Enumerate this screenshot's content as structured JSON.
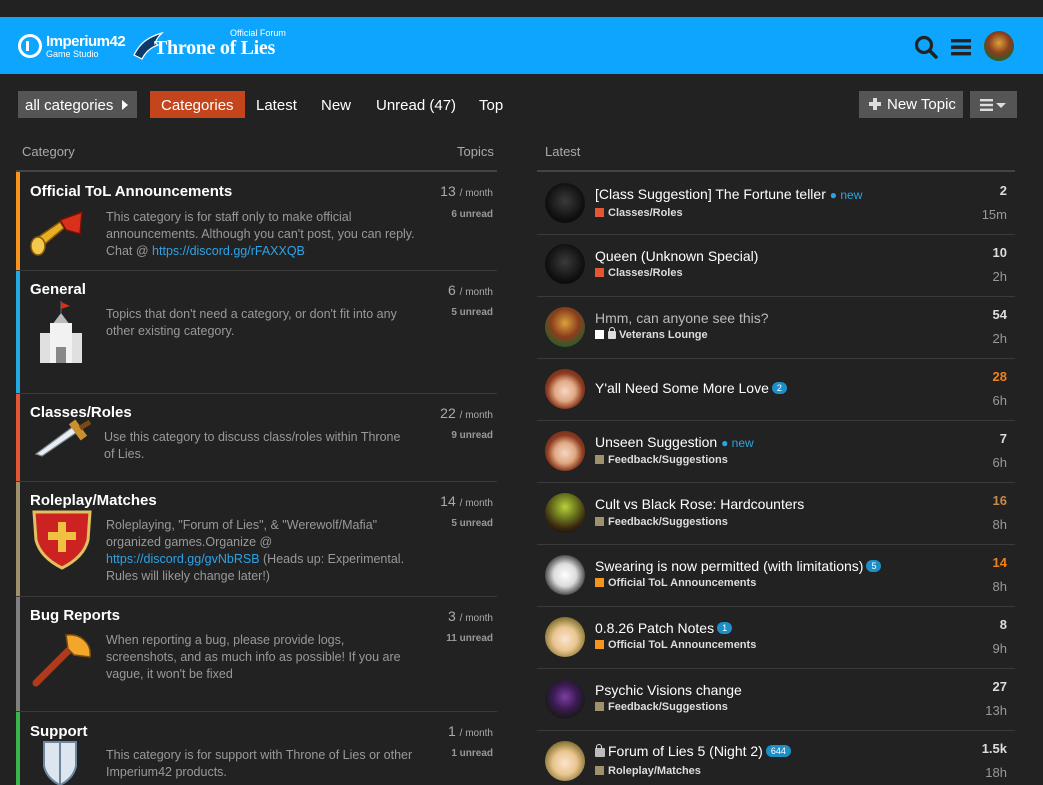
{
  "header": {
    "logo_main": "Imperium42",
    "logo_sub": "Game Studio",
    "forum_tag": "Official Forum",
    "forum_name": "Throne of Lies",
    "brand_color": "#0ea5ff"
  },
  "nav": {
    "category_dropdown": "all categories",
    "tabs": [
      {
        "label": "Categories",
        "active": true
      },
      {
        "label": "Latest"
      },
      {
        "label": "New"
      },
      {
        "label": "Unread (47)"
      },
      {
        "label": "Top"
      }
    ],
    "new_topic": "New Topic"
  },
  "categories_column": {
    "header": "Category",
    "topics_header": "Topics"
  },
  "latest_column": {
    "header": "Latest"
  },
  "categories": [
    {
      "name": "Official ToL Announcements",
      "desc_a": "This category is for staff only to make official announcements. Although you can't post, you can reply. Chat @ ",
      "link": "https://discord.gg/rFAXXQB",
      "desc_b": "",
      "count": "13",
      "unit": "/ month",
      "unread": "6 unread",
      "color": "#f7941d",
      "icon": "horn-icon"
    },
    {
      "name": "General",
      "desc_a": "Topics that don't need a category, or don't fit into any other existing category.",
      "link": "",
      "desc_b": "",
      "count": "6",
      "unit": "/ month",
      "unread": "5 unread",
      "color": "#25aae2",
      "icon": "castle-icon"
    },
    {
      "name": "Classes/Roles",
      "desc_a": "Use this category to discuss class/roles within Throne of Lies.",
      "link": "",
      "desc_b": "",
      "count": "22",
      "unit": "/ month",
      "unread": "9 unread",
      "color": "#e45735",
      "icon": "dagger-icon"
    },
    {
      "name": "Roleplay/Matches",
      "desc_a": "Roleplaying, \"Forum of Lies\", & \"Werewolf/Mafia\" organized games.Organize @ ",
      "link": "https://discord.gg/gvNbRSB",
      "desc_b": " (Heads up: Experimental. Rules will likely change later!)",
      "count": "14",
      "unit": "/ month",
      "unread": "5 unread",
      "color": "#a0916d",
      "icon": "shield-cross-icon"
    },
    {
      "name": "Bug Reports",
      "desc_a": "When reporting a bug, please provide logs, screenshots, and as much info as possible! If you are vague, it won't be fixed",
      "link": "",
      "desc_b": "",
      "count": "3",
      "unit": "/ month",
      "unread": "11 unread",
      "color": "#808080",
      "icon": "axe-icon"
    },
    {
      "name": "Support",
      "desc_a": "This category is for support with Throne of Lies or other Imperium42 products.",
      "link": "",
      "desc_b": "",
      "count": "1",
      "unit": "/ month",
      "unread": "1 unread",
      "color": "#3ab54a",
      "icon": "shield-icon"
    }
  ],
  "topics": [
    {
      "title": "[Class Suggestion] The Fortune teller",
      "new": "● new",
      "badge": "",
      "category": "Classes/Roles",
      "cat_color": "#e45735",
      "locked": false,
      "posts": "2",
      "posts_style": "",
      "age": "15m",
      "avatar": "dark-figure"
    },
    {
      "title": "Queen (Unknown Special)",
      "new": "",
      "badge": "",
      "category": "Classes/Roles",
      "cat_color": "#e45735",
      "locked": false,
      "posts": "10",
      "posts_style": "",
      "age": "2h",
      "avatar": "dark-figure"
    },
    {
      "title": "Hmm, can anyone see this?",
      "new": "",
      "badge": "",
      "category": "Veterans Lounge",
      "cat_color": "#ffffff",
      "locked": true,
      "posts": "54",
      "posts_style": "",
      "age": "2h",
      "avatar": "king-portrait",
      "read": true
    },
    {
      "title": "Y'all Need Some More Love",
      "new": "",
      "badge": "2",
      "category": "",
      "cat_color": "",
      "locked": false,
      "posts": "28",
      "posts_style": "hot",
      "age": "6h",
      "avatar": "anime-girl-brown"
    },
    {
      "title": "Unseen Suggestion",
      "new": "● new",
      "badge": "",
      "category": "Feedback/Suggestions",
      "cat_color": "#a0916d",
      "locked": false,
      "posts": "7",
      "posts_style": "",
      "age": "6h",
      "avatar": "anime-girl-brown"
    },
    {
      "title": "Cult vs Black Rose: Hardcounters",
      "new": "",
      "badge": "",
      "category": "Feedback/Suggestions",
      "cat_color": "#a0916d",
      "locked": false,
      "posts": "16",
      "posts_style": "warm",
      "age": "8h",
      "avatar": "goblin"
    },
    {
      "title": "Swearing is now permitted (with limitations)",
      "new": "",
      "badge": "5",
      "category": "Official ToL Announcements",
      "cat_color": "#f7941d",
      "locked": false,
      "posts": "14",
      "posts_style": "hot",
      "age": "8h",
      "avatar": "sketch-girl"
    },
    {
      "title": "0.8.26 Patch Notes",
      "new": "",
      "badge": "1",
      "category": "Official ToL Announcements",
      "cat_color": "#f7941d",
      "locked": false,
      "posts": "8",
      "posts_style": "",
      "age": "9h",
      "avatar": "anime-girl-blonde"
    },
    {
      "title": "Psychic Visions change",
      "new": "",
      "badge": "",
      "category": "Feedback/Suggestions",
      "cat_color": "#a0916d",
      "locked": false,
      "posts": "27",
      "posts_style": "",
      "age": "13h",
      "avatar": "purple-mage"
    },
    {
      "title": "Forum of Lies 5 (Night 2)",
      "new": "",
      "badge": "644",
      "category": "Roleplay/Matches",
      "cat_color": "#a0916d",
      "locked": true,
      "posts": "1.5k",
      "posts_style": "",
      "age": "18h",
      "avatar": "anime-girl-blonde"
    }
  ]
}
